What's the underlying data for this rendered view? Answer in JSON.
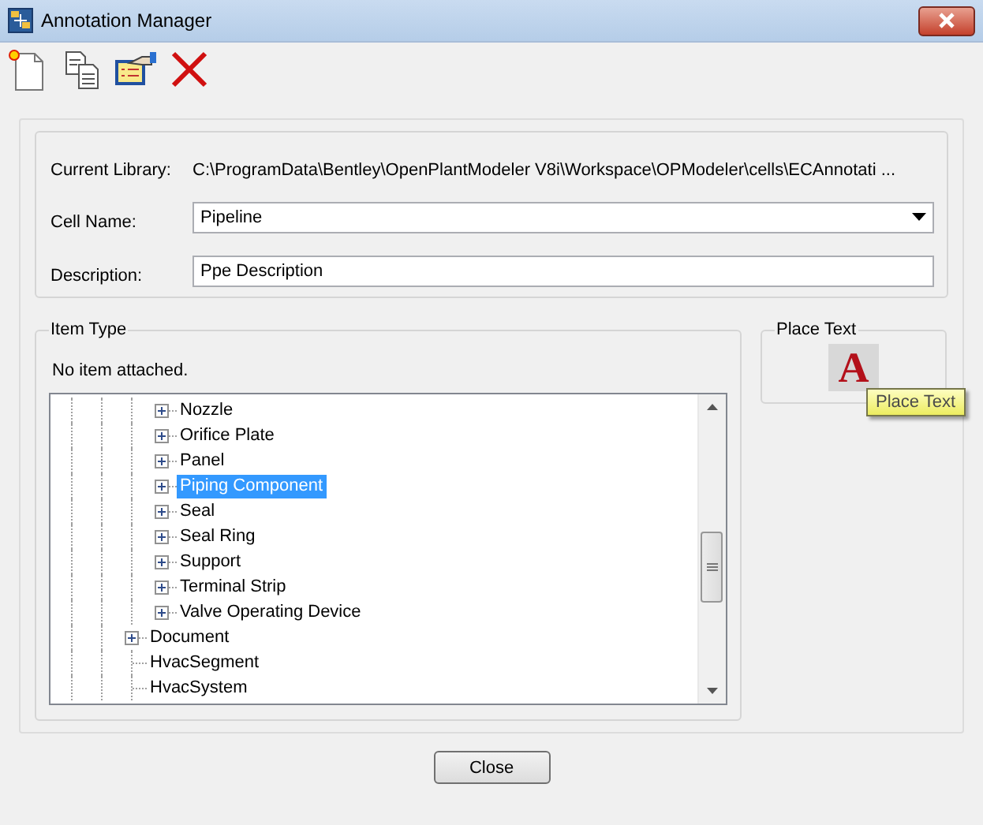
{
  "window": {
    "title": "Annotation Manager"
  },
  "library": {
    "current_library_label": "Current Library:",
    "current_library": "C:\\ProgramData\\Bentley\\OpenPlantModeler V8i\\Workspace\\OPModeler\\cells\\ECAnnotati ...",
    "cell_name_label": "Cell Name:",
    "cell_name": "Pipeline",
    "description_label": "Description:",
    "description": "Ppe Description"
  },
  "item_type": {
    "title": "Item Type",
    "status": "No item attached.",
    "tree": [
      {
        "children": [
          {
            "label": "Nozzle",
            "expandable": true,
            "selected": false
          },
          {
            "label": "Orifice Plate",
            "expandable": true,
            "selected": false
          },
          {
            "label": "Panel",
            "expandable": true,
            "selected": false
          },
          {
            "label": "Piping Component",
            "expandable": true,
            "selected": true
          },
          {
            "label": "Seal",
            "expandable": true,
            "selected": false
          },
          {
            "label": "Seal Ring",
            "expandable": true,
            "selected": false
          },
          {
            "label": "Support",
            "expandable": true,
            "selected": false
          },
          {
            "label": "Terminal Strip",
            "expandable": true,
            "selected": false
          },
          {
            "label": "Valve Operating Device",
            "expandable": true,
            "selected": false
          }
        ]
      },
      {
        "label": "Document",
        "expandable": true,
        "selected": false
      },
      {
        "label": "HvacSegment",
        "expandable": false,
        "selected": false
      },
      {
        "label": "HvacSystem",
        "expandable": false,
        "selected": false
      }
    ]
  },
  "place_text": {
    "title": "Place Text",
    "button_glyph": "A",
    "tooltip": "Place Text"
  },
  "buttons": [
    "Close"
  ]
}
